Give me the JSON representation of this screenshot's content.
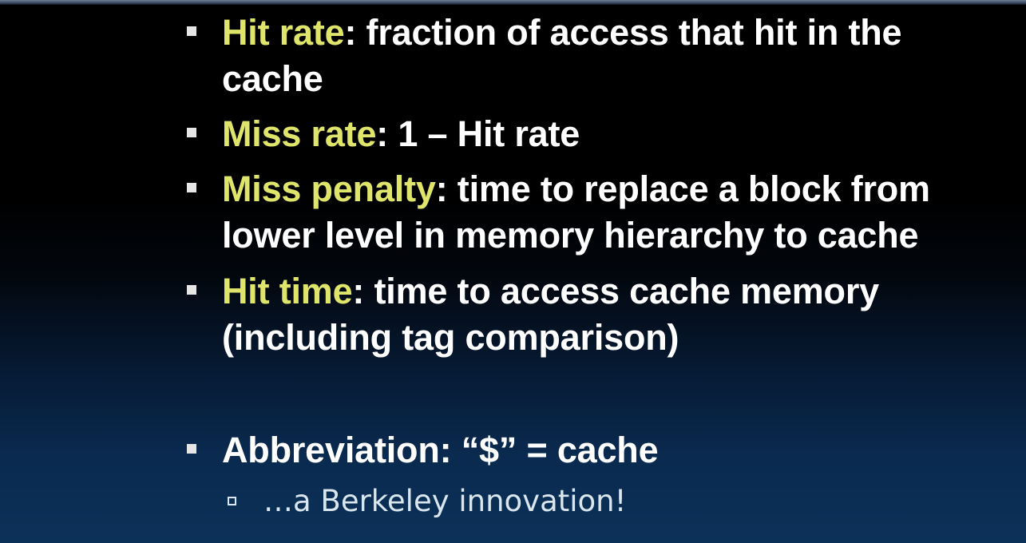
{
  "bullets": [
    {
      "term": "Hit rate",
      "rest": ": fraction of access that hit in the cache"
    },
    {
      "term": "Miss rate",
      "rest": ": 1 – Hit rate"
    },
    {
      "term": "Miss penalty",
      "rest": ": time to replace a block from lower level in memory hierarchy to cache"
    },
    {
      "term": "Hit time",
      "rest": ": time to access cache memory (including tag comparison)"
    }
  ],
  "abbreviation": {
    "text": "Abbreviation: “$” = cache",
    "sub": "…a Berkeley innovation!"
  }
}
